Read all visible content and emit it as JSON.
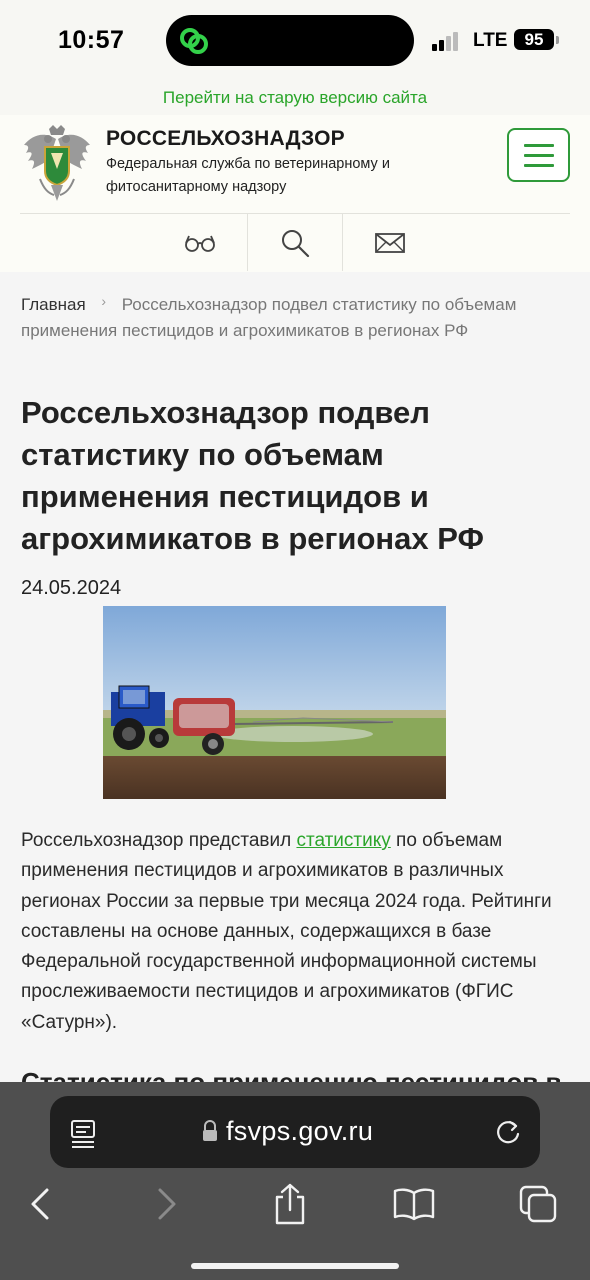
{
  "status_bar": {
    "time": "10:57",
    "network": "LTE",
    "battery": "95"
  },
  "top_link": "Перейти на старую версию сайта",
  "header": {
    "org_name": "РОССЕЛЬХОЗНАДЗОР",
    "org_desc": "Федеральная служба по ветеринарному и фитосанитарному надзору",
    "tools": [
      "glasses-icon",
      "search-icon",
      "mail-icon"
    ]
  },
  "breadcrumb": {
    "home": "Главная",
    "current": "Россельхознадзор подвел статистику по объемам применения пестицидов и агрохимикатов в регионах РФ"
  },
  "article": {
    "title": "Россельхознадзор подвел статистику по объемам применения пестицидов и агрохимикатов в регионах РФ",
    "date": "24.05.2024",
    "body_before_link": "Россельхознадзор представил ",
    "link_text": "статистику",
    "body_after_link": " по объемам применения пестицидов и агрохимикатов в различных регионах России за первые три месяца 2024 года. Рейтинги составлены на основе данных, содержащихся в базе Федеральной государственной информационной системы прослеживаемости пестицидов и агрохимикатов (ФГИС «Сатурн»).",
    "subheading": "Статистика по применению пестицидов в"
  },
  "browser": {
    "url": "fsvps.gov.ru",
    "nav_icons": [
      "back-icon",
      "forward-icon",
      "share-icon",
      "bookmarks-icon",
      "tabs-icon"
    ]
  },
  "colors": {
    "accent_green": "#2aa52a",
    "menu_green": "#2f9a3a",
    "browser_bar": "#4f4f4f",
    "url_pill": "#1f1f1f"
  }
}
